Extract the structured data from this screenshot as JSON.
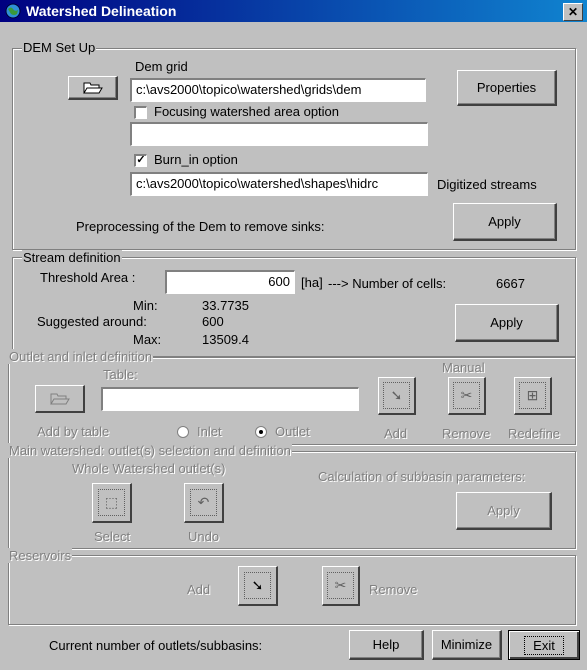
{
  "window": {
    "title": "Watershed Delineation",
    "close_glyph": "✕"
  },
  "dem": {
    "legend": "DEM Set Up",
    "dem_grid_label": "Dem grid",
    "dem_grid_value": "c:\\avs2000\\topico\\watershed\\grids\\dem",
    "properties_label": "Properties",
    "focusing_label": "Focusing watershed  area option",
    "focusing_checked": false,
    "focusing_value": "",
    "burn_label": "Burn_in option",
    "burn_checked": true,
    "burn_value": "c:\\avs2000\\topico\\watershed\\shapes\\hidrc",
    "digitized_label": "Digitized streams",
    "preprocess_label": "Preprocessing of the Dem to remove sinks:",
    "apply_label": "Apply"
  },
  "stream": {
    "legend": "Stream definition",
    "threshold_label": "Threshold Area :",
    "threshold_value": "600",
    "unit": "[ha]",
    "cells_label": "---> Number of cells:",
    "cells_value": "6667",
    "min_label": "Min:",
    "min_value": "33.7735",
    "suggested_label": "Suggested around:",
    "suggested_value": "600",
    "max_label": "Max:",
    "max_value": "13509.4",
    "apply_label": "Apply"
  },
  "outlet": {
    "legend": "Outlet  and inlet definition",
    "table_label": "Table:",
    "manual_label": "Manual",
    "add_by_table_label": "Add by table",
    "inlet_label": "Inlet",
    "outlet_label": "Outlet",
    "selected_radio": "Outlet",
    "add_label": "Add",
    "remove_label": "Remove",
    "redefine_label": "Redefine"
  },
  "main_ws": {
    "legend": "Main watershed: outlet(s) selection and definition",
    "whole_label": "Whole Watershed outlet(s)",
    "select_label": "Select",
    "undo_label": "Undo",
    "calc_label": "Calculation of subbasin parameters:",
    "apply_label": "Apply"
  },
  "reservoirs": {
    "legend": "Reservoirs",
    "add_label": "Add",
    "remove_label": "Remove"
  },
  "footer": {
    "count_label": "Current number of outlets/subbasins:",
    "help_label": "Help",
    "minimize_label": "Minimize",
    "exit_label": "Exit"
  },
  "icons": {
    "app": "globe-icon",
    "open_folder": "open-folder-icon",
    "add_point": "add-point-icon",
    "remove_point": "remove-point-icon",
    "redefine": "redefine-icon",
    "select": "select-box-icon",
    "undo": "undo-icon"
  }
}
